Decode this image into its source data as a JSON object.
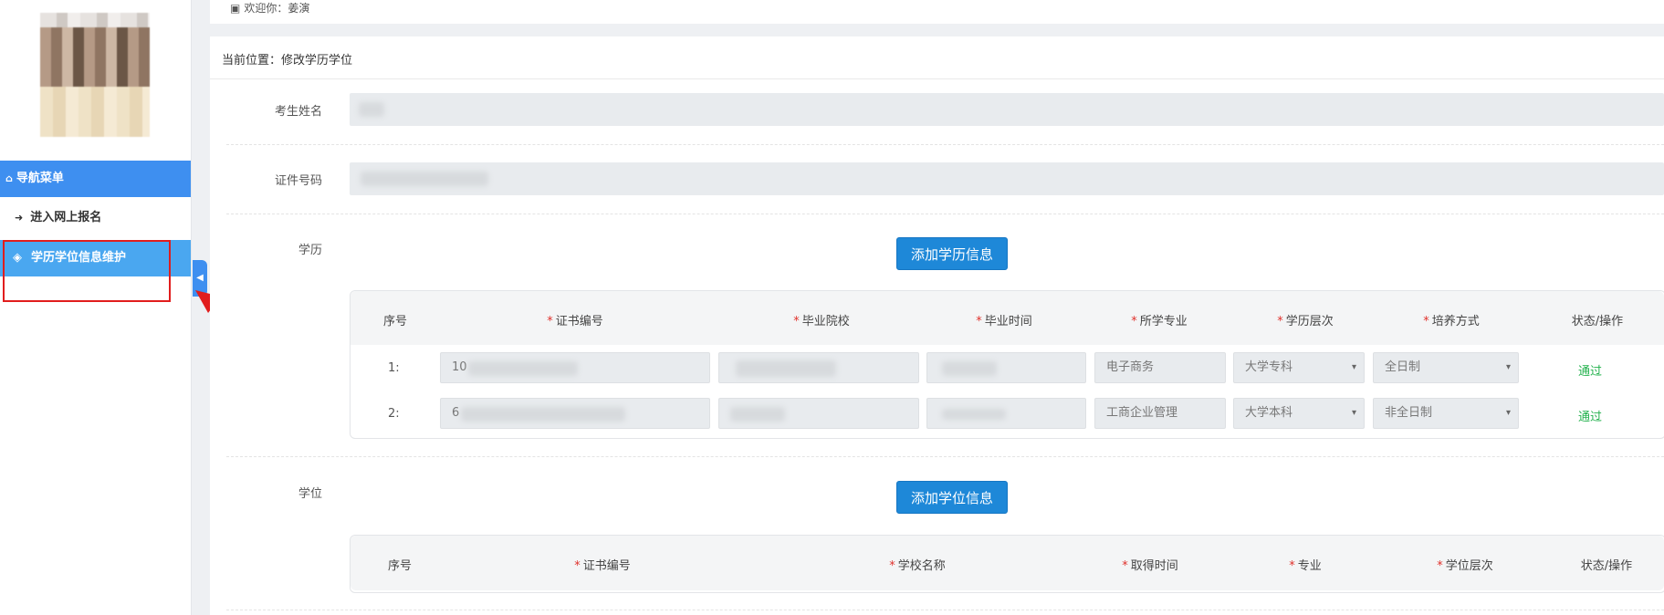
{
  "topbar": {
    "welcome": "欢迎你：姜演"
  },
  "sidebar": {
    "nav_header": "导航菜单",
    "items": [
      {
        "label": "进入网上报名"
      },
      {
        "label": "学历学位信息维护"
      }
    ]
  },
  "breadcrumb": "当前位置：修改学历学位",
  "form": {
    "name_label": "考生姓名",
    "id_label": "证件号码",
    "education_label": "学历",
    "degree_label": "学位",
    "add_education_button": "添加学历信息",
    "add_degree_button": "添加学位信息"
  },
  "education_table": {
    "headers": [
      "序号",
      "证书编号",
      "毕业院校",
      "毕业时间",
      "所学专业",
      "学历层次",
      "培养方式",
      "状态/操作"
    ],
    "required": [
      false,
      true,
      true,
      true,
      true,
      true,
      true,
      false
    ],
    "rows": [
      {
        "num": "1:",
        "cert": "10",
        "major": "电子商务",
        "level": "大学专科",
        "mode": "全日制",
        "status": "通过"
      },
      {
        "num": "2:",
        "cert": "6",
        "major": "工商企业管理",
        "level": "大学本科",
        "mode": "非全日制",
        "status": "通过"
      }
    ]
  },
  "degree_table": {
    "headers": [
      "序号",
      "证书编号",
      "学校名称",
      "取得时间",
      "专业",
      "学位层次",
      "状态/操作"
    ],
    "required": [
      false,
      true,
      true,
      true,
      true,
      true,
      false
    ]
  },
  "colors": {
    "accent": "#3e8ff0",
    "button": "#1e88d8",
    "status_pass": "#22b14c",
    "required": "#e0312b",
    "annotation": "#e11d1d"
  },
  "icons": [
    "bank-icon",
    "home-icon",
    "sign-in-icon",
    "graduation-cap-icon",
    "chevron-left-icon"
  ]
}
